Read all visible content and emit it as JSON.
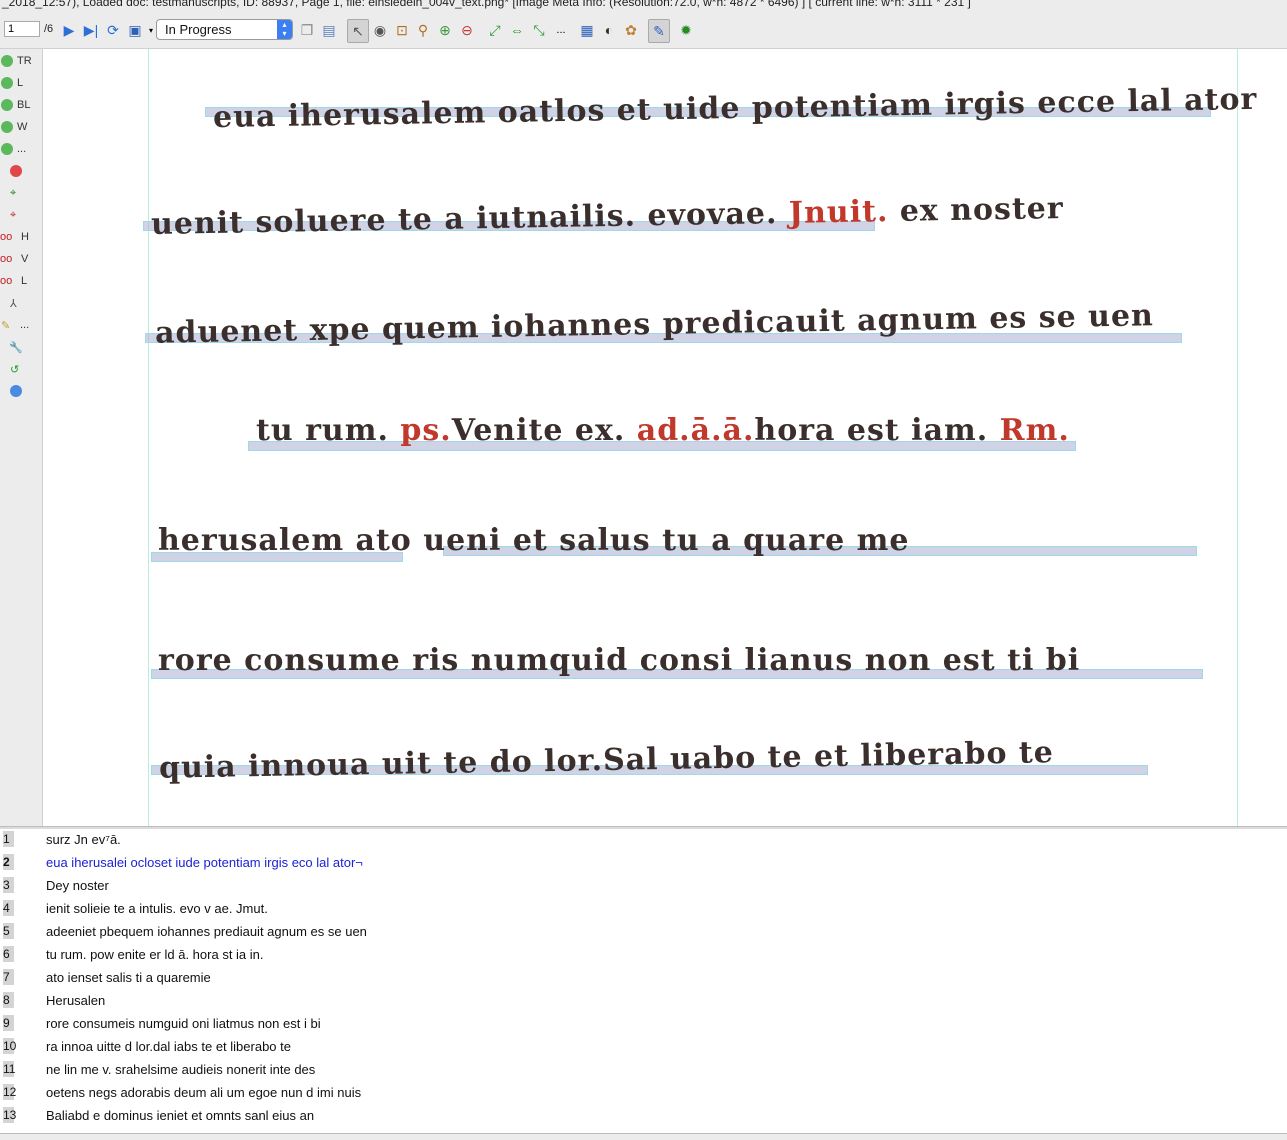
{
  "title_bar": {
    "text": "_2018_12:57), Loaded doc: testmanuscripts, ID: 88937, Page 1, file: einsiedeln_004v_text.png* [Image Meta Info: (Resolution:72.0, w*h: 4872 * 6496) ] [ current line: w*h: 3111 * 231 ]"
  },
  "toolbar": {
    "page_number": "1",
    "page_total": "/6",
    "status_value": "In Progress",
    "icons": [
      "next-page-icon",
      "last-page-icon",
      "reload-icon",
      "save-icon",
      "copy-icon",
      "page-icon",
      "select-arrow-icon",
      "eye-icon",
      "zoom-box-icon",
      "zoom-icon",
      "zoom-in-icon",
      "zoom-out-icon",
      "fit-page-icon",
      "fit-width-icon",
      "fit-height-icon",
      "more-icon",
      "image-icon",
      "contrast-icon",
      "palette-icon",
      "edit-icon",
      "bug-icon"
    ],
    "more_label": "..."
  },
  "leftbar": {
    "items": [
      {
        "label": "TR",
        "icon": "add-icon"
      },
      {
        "label": "L",
        "icon": "add-icon"
      },
      {
        "label": "BL",
        "icon": "add-icon"
      },
      {
        "label": "W",
        "icon": "add-icon"
      },
      {
        "label": "...",
        "icon": "add-icon"
      },
      {
        "label": "",
        "icon": "delete-icon"
      },
      {
        "label": "",
        "icon": "add-shape-icon"
      },
      {
        "label": "",
        "icon": "remove-shape-icon"
      },
      {
        "label": "H",
        "icon": "split-icon"
      },
      {
        "label": "V",
        "icon": "split-icon"
      },
      {
        "label": "L",
        "icon": "split-icon"
      },
      {
        "label": "",
        "icon": "merge-icon"
      },
      {
        "label": "...",
        "icon": "edit-icon"
      },
      {
        "label": "",
        "icon": "wrench-icon"
      },
      {
        "label": "",
        "icon": "undo-icon"
      },
      {
        "label": "",
        "icon": "help-icon"
      }
    ]
  },
  "manuscript": {
    "lines": [
      {
        "parts": [
          {
            "text": "eua iherusalem oatlos",
            "red": false
          },
          {
            "text": "   et uide potentiam irgis ecce lal  ator",
            "red": false
          }
        ]
      },
      {
        "parts": [
          {
            "text": "uenit soluere te a iutnailis. evovae. ",
            "red": false
          },
          {
            "text": "Jnuit.",
            "red": true
          },
          {
            "text": "        ex noster",
            "red": false
          }
        ]
      },
      {
        "parts": [
          {
            "text": "aduenet xpe     quem iohannes predicauit  agnum es se uen",
            "red": false
          }
        ]
      },
      {
        "parts": [
          {
            "text": "tu  rum. ",
            "red": false
          },
          {
            "text": "ps.",
            "red": true
          },
          {
            "text": "Venite ex. ",
            "red": false
          },
          {
            "text": "ad.ā.ā.",
            "red": true
          },
          {
            "text": "hora est iam.   ",
            "red": false
          },
          {
            "text": "Rm.",
            "red": true
          }
        ]
      },
      {
        "parts": [
          {
            "text": "herusalem      ato ueni    et salus tu    a quare     me",
            "red": false
          }
        ]
      },
      {
        "parts": [
          {
            "text": "rore   consume     ris numquid consi  lianus non  est ti  bi",
            "red": false
          }
        ]
      },
      {
        "parts": [
          {
            "text": "quia innoua   uit te   do   lor.Sal  uabo te  et liberabo te",
            "red": false
          }
        ]
      }
    ]
  },
  "transcription": {
    "lines": [
      {
        "n": "1",
        "text": "surz Jn ev⁷ā."
      },
      {
        "n": "2",
        "text": "eua iherusalei ocloset iude potentiam irgis eco lal ator¬"
      },
      {
        "n": "3",
        "text": "Dey noster"
      },
      {
        "n": "4",
        "text": "ienit solieie te a intulis. evo v ae. Jmut."
      },
      {
        "n": "5",
        "text": "adeeniet pbequem iohannes prediauit agnum es se uen"
      },
      {
        "n": "6",
        "text": "tu rum. pow enite er ld  ā. hora st ia in."
      },
      {
        "n": "7",
        "text": "ato ienset salis ti a quaremie"
      },
      {
        "n": "8",
        "text": "Herusalen"
      },
      {
        "n": "9",
        "text": "rore consumeis numguid oni liatmus non est i bi"
      },
      {
        "n": "10",
        "text": "ra innoa uitte d lor.dal iabs te et liberabo te"
      },
      {
        "n": "11",
        "text": "ne lin me v. srahelsime audieis nonerit inte des"
      },
      {
        "n": "12",
        "text": "oetens negs adorabis deum ali um egoe nun d imi nuis"
      },
      {
        "n": "13",
        "text": "Baliabd e dominus ieniet et omnts sanl eius an"
      }
    ],
    "selected_index": 1
  }
}
